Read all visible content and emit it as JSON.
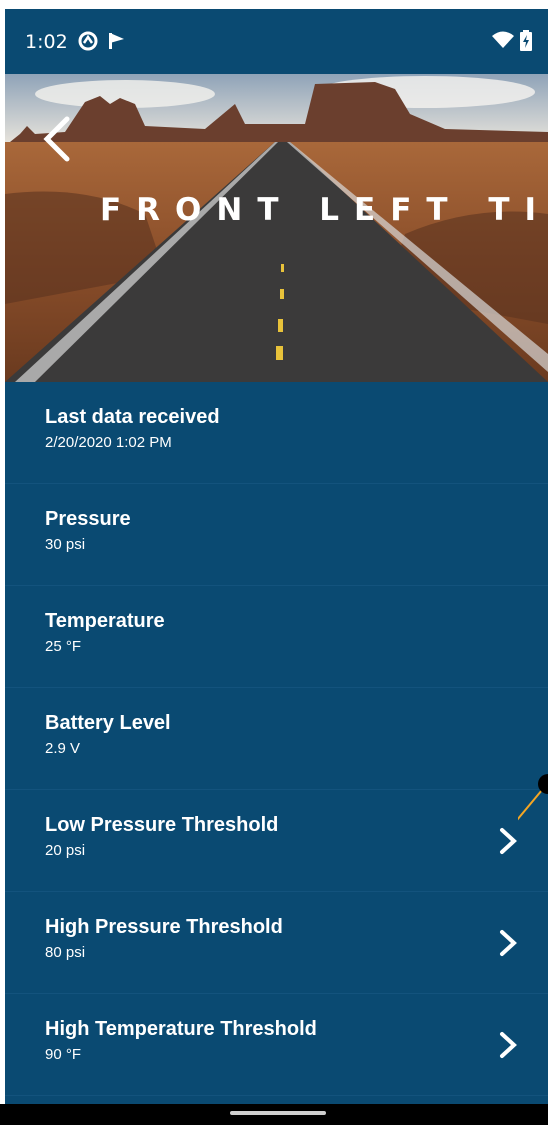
{
  "status_bar": {
    "time": "1:02",
    "left_icons": [
      "sync-circle-icon",
      "flag-icon"
    ],
    "right_icons": [
      "wifi-icon",
      "battery-charging-icon"
    ]
  },
  "header": {
    "title": "FRONT LEFT TIRE",
    "back_icon": "back-chevron-icon"
  },
  "items": [
    {
      "label": "Last data received",
      "value": "2/20/2020 1:02 PM",
      "has_chevron": false
    },
    {
      "label": "Pressure",
      "value": "30 psi",
      "has_chevron": false
    },
    {
      "label": "Temperature",
      "value": "25 °F",
      "has_chevron": false
    },
    {
      "label": "Battery Level",
      "value": "2.9 V",
      "has_chevron": false
    },
    {
      "label": "Low Pressure Threshold",
      "value": "20 psi",
      "has_chevron": true
    },
    {
      "label": "High Pressure Threshold",
      "value": "80 psi",
      "has_chevron": true
    },
    {
      "label": "High Temperature Threshold",
      "value": "90 °F",
      "has_chevron": true
    }
  ],
  "colors": {
    "background": "#0a4a72",
    "text": "#ffffff",
    "touch_indicator": "#f5a623"
  }
}
